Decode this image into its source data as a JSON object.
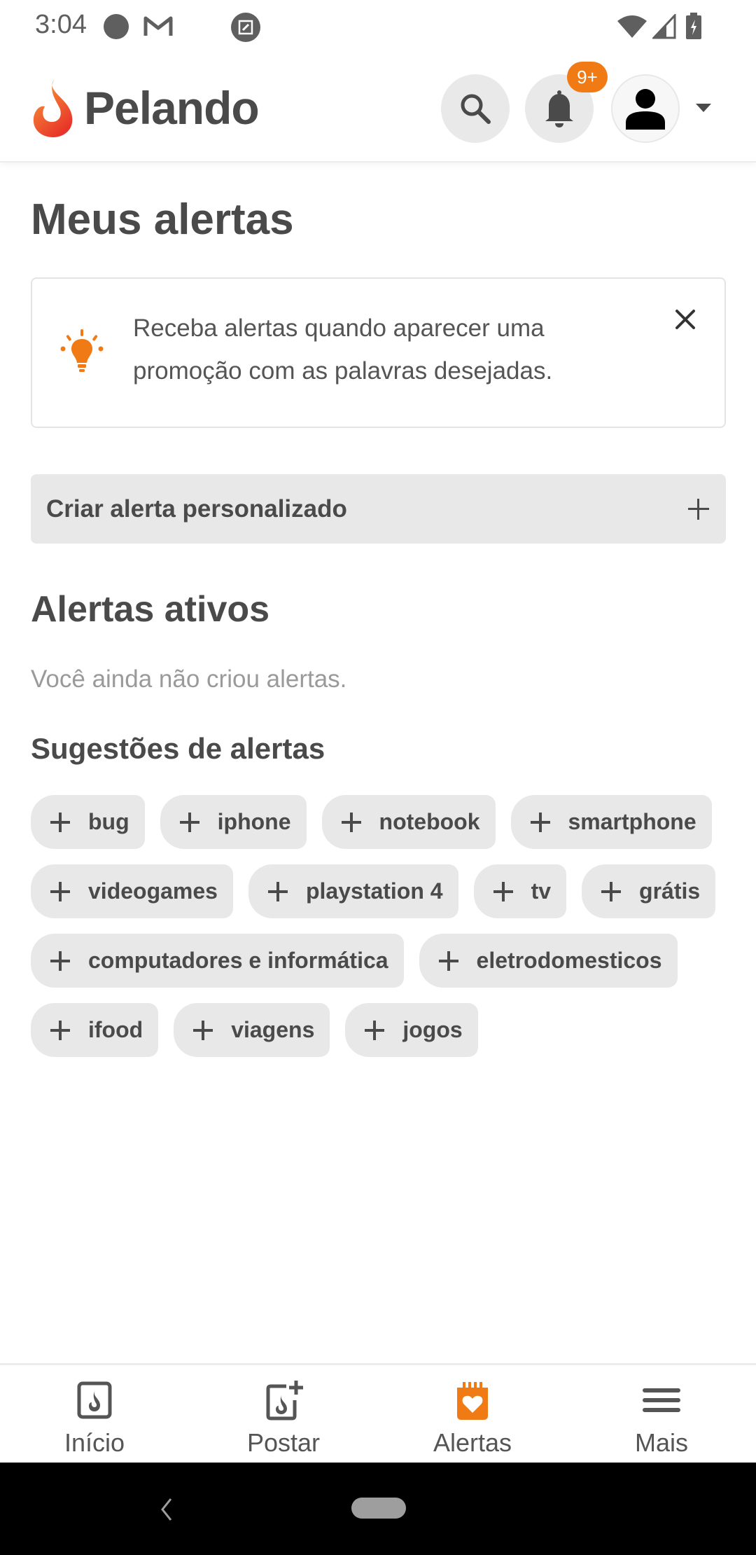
{
  "status_bar": {
    "time": "3:04",
    "icons": [
      "notification-dot-icon",
      "gmail-icon",
      "screenshot-edit-icon",
      "wifi-icon",
      "cell-signal-icon",
      "battery-charging-icon"
    ]
  },
  "header": {
    "brand": "Pelando",
    "notification_badge": "9+",
    "colors": {
      "accent": "#f07b14",
      "text": "#4a4a4a"
    }
  },
  "page": {
    "title": "Meus alertas",
    "info_card": {
      "text": "Receba alertas quando aparecer uma promoção com as palavras desejadas."
    },
    "create_alert_label": "Criar alerta personalizado",
    "active_section_title": "Alertas ativos",
    "empty_message": "Você ainda não criou alertas.",
    "suggestions_title": "Sugestões de alertas",
    "suggestions": [
      "bug",
      "iphone",
      "notebook",
      "smartphone",
      "videogames",
      "playstation 4",
      "tv",
      "grátis",
      "computadores e informática",
      "eletrodomesticos",
      "ifood",
      "viagens",
      "jogos"
    ]
  },
  "bottom_nav": {
    "items": [
      {
        "label": "Início",
        "icon": "home-flame-icon",
        "active": false
      },
      {
        "label": "Postar",
        "icon": "post-add-icon",
        "active": false
      },
      {
        "label": "Alertas",
        "icon": "alerts-heart-icon",
        "active": true
      },
      {
        "label": "Mais",
        "icon": "menu-icon",
        "active": false
      }
    ]
  }
}
